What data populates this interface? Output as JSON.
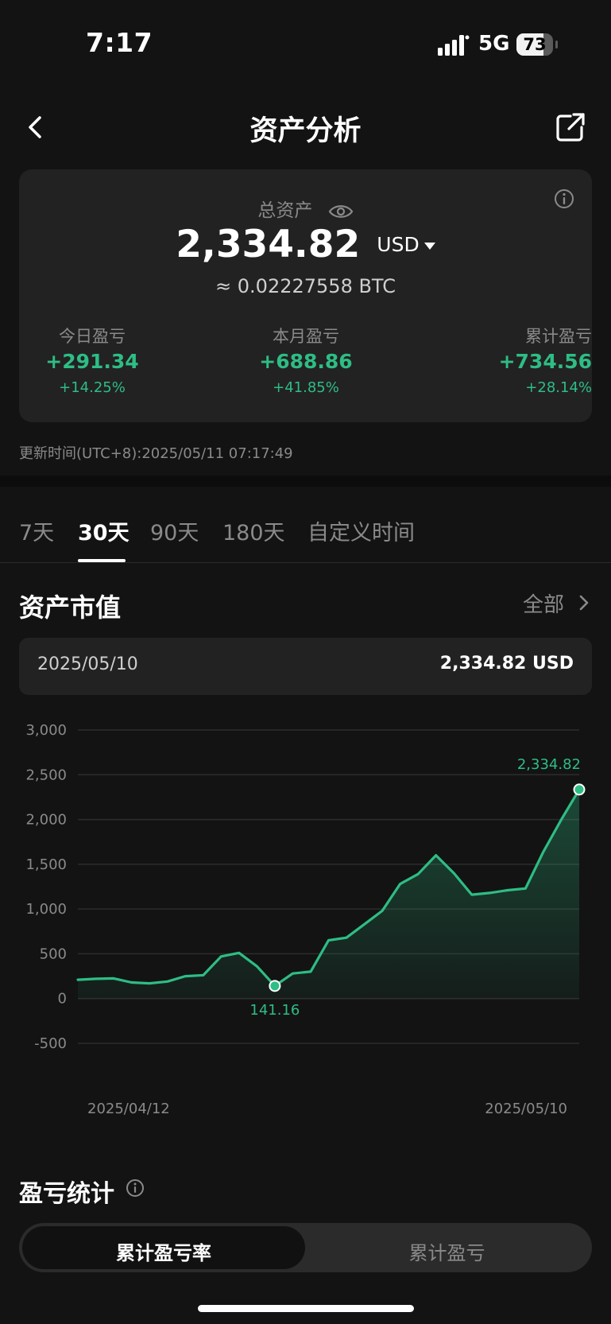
{
  "status_bar": {
    "time": "7:17",
    "network": "5G",
    "battery": "73",
    "battery_level": 0.73
  },
  "header": {
    "title": "资产分析",
    "back_icon": "chevron-left-icon",
    "share_icon": "share-icon"
  },
  "asset_card": {
    "total_label": "总资产",
    "total_value": "2,334.82",
    "currency": "USD",
    "btc_equivalent": "≈ 0.02227558 BTC",
    "today": {
      "label": "今日盈亏",
      "value": "+291.34",
      "pct": "+14.25%"
    },
    "month": {
      "label": "本月盈亏",
      "value": "+688.86",
      "pct": "+41.85%"
    },
    "cumulative": {
      "label": "累计盈亏",
      "value": "+734.56",
      "pct": "+28.14%"
    }
  },
  "update_time": "更新时间(UTC+8):2025/05/11 07:17:49",
  "tabs": [
    {
      "label": "7天"
    },
    {
      "label": "30天",
      "active": true
    },
    {
      "label": "90天"
    },
    {
      "label": "180天"
    },
    {
      "label": "自定义时间"
    }
  ],
  "market_value": {
    "title": "资产市值",
    "all_label": "全部",
    "selected_date": "2025/05/10",
    "selected_value": "2,334.82 USD"
  },
  "chart_data": {
    "type": "area",
    "x_start_label": "2025/04/12",
    "x_end_label": "2025/05/10",
    "yticks": [
      "3,000",
      "2,500",
      "2,000",
      "1,500",
      "1,000",
      "500",
      "0",
      "-500"
    ],
    "ylim": [
      -500,
      3000
    ],
    "values": [
      210,
      220,
      225,
      180,
      170,
      190,
      250,
      260,
      470,
      510,
      360,
      141.16,
      280,
      300,
      650,
      680,
      830,
      980,
      1280,
      1390,
      1600,
      1400,
      1160,
      1180,
      1210,
      1230,
      1640,
      2000,
      2334.82
    ],
    "min_label": "141.16",
    "max_label": "2,334.82",
    "line_color": "#2ebd85"
  },
  "pnl_stats": {
    "title": "盈亏统计",
    "toggle_active": "累计盈亏率",
    "toggle_inactive": "累计盈亏"
  }
}
